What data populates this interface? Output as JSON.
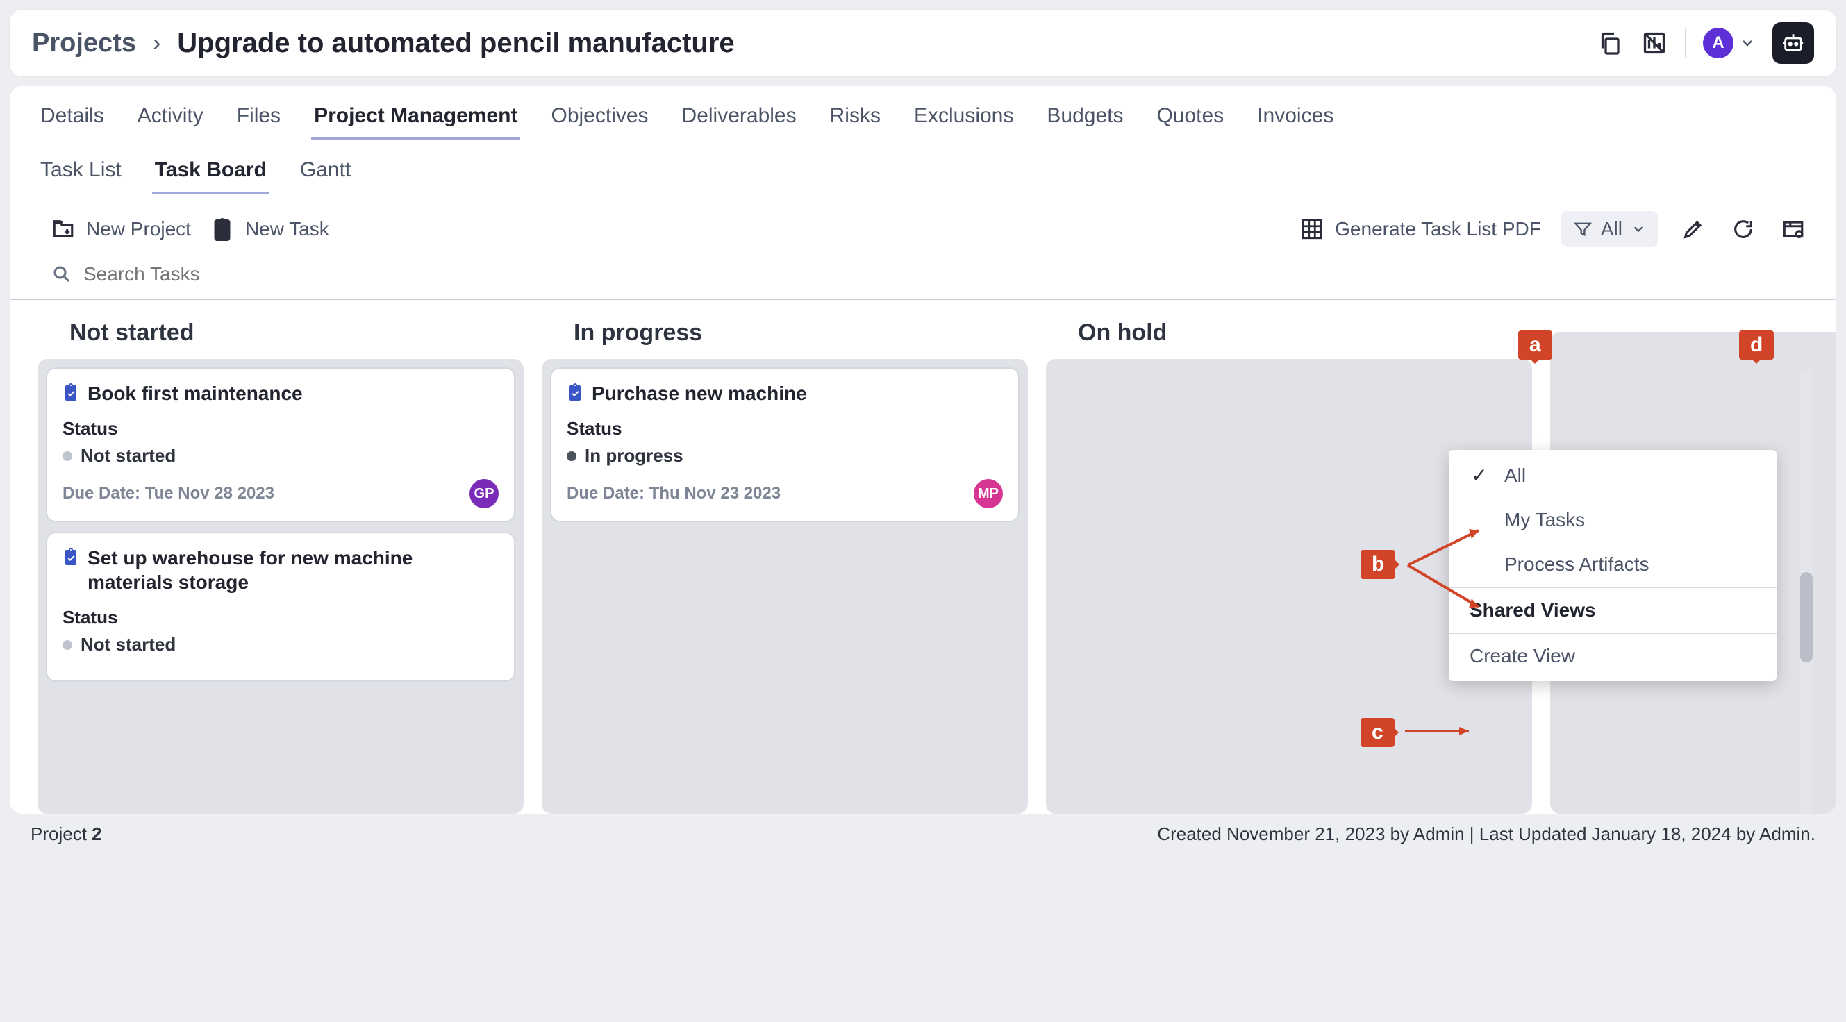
{
  "header": {
    "breadcrumb_root": "Projects",
    "title": "Upgrade to automated pencil manufacture",
    "user_initial": "A"
  },
  "tabs": {
    "items": [
      "Details",
      "Activity",
      "Files",
      "Project Management",
      "Objectives",
      "Deliverables",
      "Risks",
      "Exclusions",
      "Budgets",
      "Quotes",
      "Invoices"
    ],
    "active": "Project Management"
  },
  "subtabs": {
    "items": [
      "Task List",
      "Task Board",
      "Gantt"
    ],
    "active": "Task Board"
  },
  "toolbar": {
    "new_project": "New Project",
    "new_task": "New Task",
    "generate_pdf": "Generate Task List PDF",
    "filter_label": "All"
  },
  "search": {
    "placeholder": "Search Tasks"
  },
  "filter_menu": {
    "items": [
      {
        "label": "All",
        "selected": true
      },
      {
        "label": "My Tasks",
        "selected": false
      },
      {
        "label": "Process Artifacts",
        "selected": false
      }
    ],
    "shared_header": "Shared Views",
    "create_label": "Create View"
  },
  "board": {
    "lanes": [
      {
        "title": "Not started",
        "cards": [
          {
            "title": "Book first maintenance",
            "status_label": "Status",
            "status": "Not started",
            "status_dot": "grey",
            "due_label": "Due Date:",
            "due": "Tue Nov 28 2023",
            "assignee": "GP",
            "assignee_color": "purple"
          },
          {
            "title": "Set up warehouse for new machine materials storage",
            "status_label": "Status",
            "status": "Not started",
            "status_dot": "grey",
            "due_label": "",
            "due": "",
            "assignee": "",
            "assignee_color": ""
          }
        ]
      },
      {
        "title": "In progress",
        "cards": [
          {
            "title": "Purchase new machine",
            "status_label": "Status",
            "status": "In progress",
            "status_dot": "dark",
            "due_label": "Due Date:",
            "due": "Thu Nov 23 2023",
            "assignee": "MP",
            "assignee_color": "mag"
          }
        ]
      },
      {
        "title": "On hold",
        "cards": []
      },
      {
        "title": "",
        "cards": []
      }
    ]
  },
  "footer": {
    "project_label": "Project",
    "project_number": "2",
    "meta": "Created November 21, 2023 by Admin | Last Updated January 18, 2024 by Admin."
  },
  "annotations": {
    "a": "a",
    "b": "b",
    "c": "c",
    "d": "d"
  }
}
